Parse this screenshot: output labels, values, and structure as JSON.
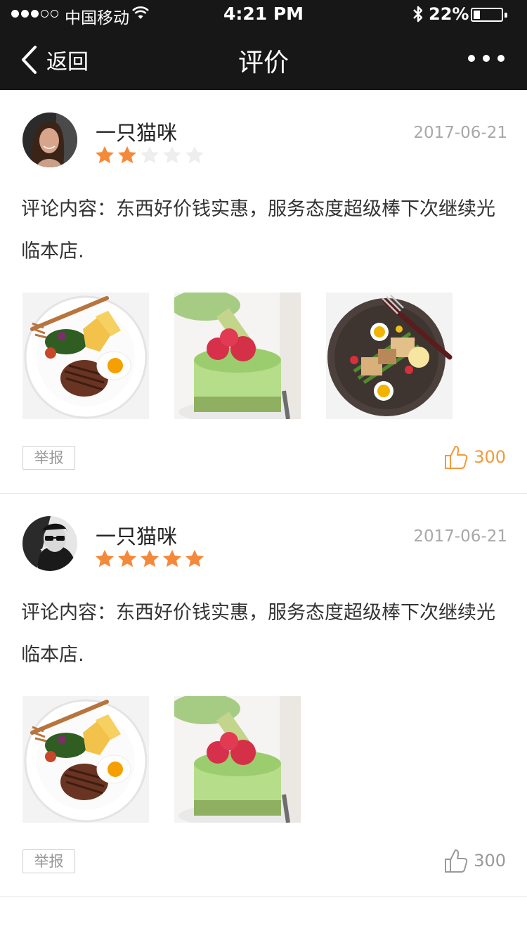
{
  "status_bar": {
    "carrier": "中国移动",
    "time": "4:21 PM",
    "battery_percent": "22%",
    "battery_level": 0.22,
    "signal_bars_filled": 3,
    "signal_bars_total": 5
  },
  "nav": {
    "back_label": "返回",
    "title": "评价",
    "more_icon": "more-dots-icon"
  },
  "colors": {
    "nav_bg": "#171717",
    "star_on": "#f5893a",
    "star_off": "#eeeeee",
    "like_active": "#f39a3a",
    "muted": "#a8a8a8"
  },
  "reviews": [
    {
      "username": "一只猫咪",
      "date": "2017-06-21",
      "rating": 2,
      "rating_max": 5,
      "content": "评论内容：东西好价钱实惠，服务态度超级棒下次继续光临本店.",
      "photos": [
        "steak-plate-photo",
        "matcha-cake-photo",
        "salad-plate-photo"
      ],
      "report_label": "举报",
      "likes": "300",
      "liked": true
    },
    {
      "username": "一只猫咪",
      "date": "2017-06-21",
      "rating": 5,
      "rating_max": 5,
      "content": "评论内容：东西好价钱实惠，服务态度超级棒下次继续光临本店.",
      "photos": [
        "steak-plate-photo",
        "matcha-cake-photo"
      ],
      "report_label": "举报",
      "likes": "300",
      "liked": false
    }
  ]
}
